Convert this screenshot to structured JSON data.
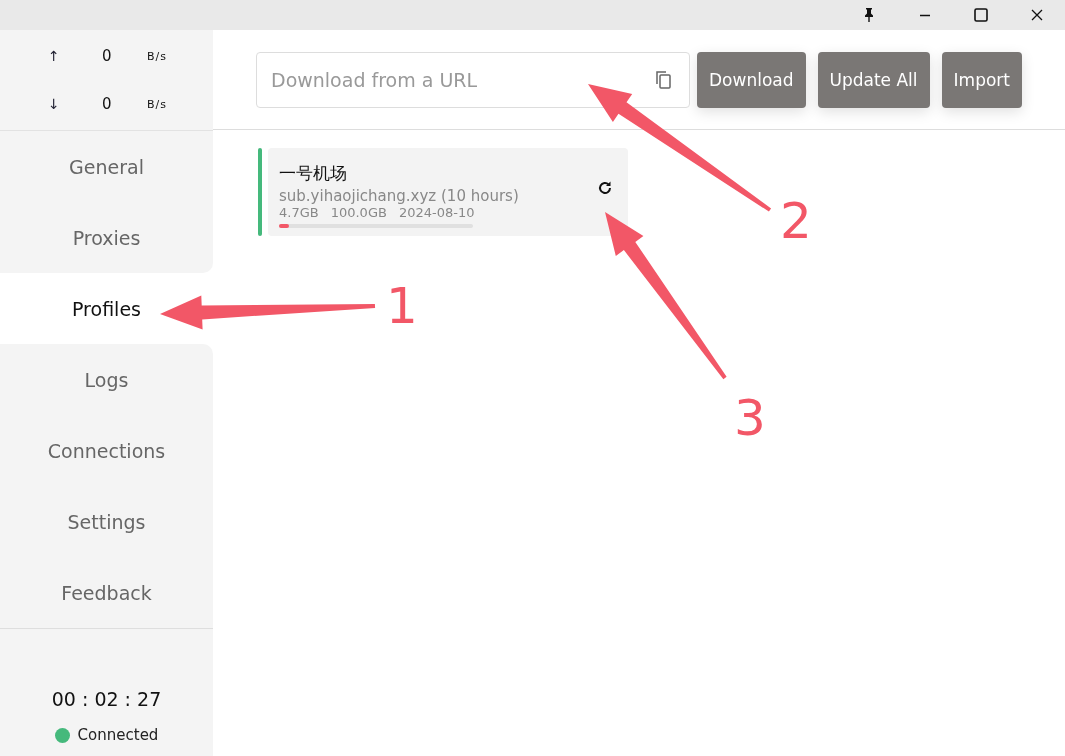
{
  "speed": [
    {
      "arrow": "↑",
      "value": "0",
      "unit": "B/s"
    },
    {
      "arrow": "↓",
      "value": "0",
      "unit": "B/s"
    }
  ],
  "sidebar": {
    "items": [
      {
        "label": "General",
        "selected": false
      },
      {
        "label": "Proxies",
        "selected": false
      },
      {
        "label": "Profiles",
        "selected": true
      },
      {
        "label": "Logs",
        "selected": false
      },
      {
        "label": "Connections",
        "selected": false
      },
      {
        "label": "Settings",
        "selected": false
      },
      {
        "label": "Feedback",
        "selected": false
      }
    ]
  },
  "status": {
    "uptime": "00 : 02 : 27",
    "connection": "Connected",
    "color": "#45b97c"
  },
  "toolbar": {
    "url_field": {
      "placeholder": "Download from a URL"
    },
    "buttons": [
      "Download",
      "Update All",
      "Import"
    ]
  },
  "profiles": [
    {
      "name": "一号机场",
      "source": "sub.yihaojichang.xyz (10 hours)",
      "used": "4.7GB",
      "total": "100.0GB",
      "expires": "2024-08-10",
      "level": 0.05,
      "selected": true
    }
  ],
  "annotations": [
    {
      "label": "1"
    },
    {
      "label": "2"
    },
    {
      "label": "3"
    }
  ]
}
